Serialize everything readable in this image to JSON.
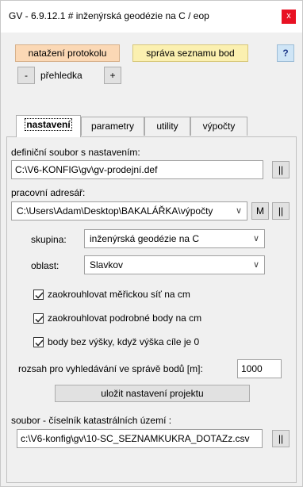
{
  "window": {
    "title": "GV - 6.9.12.1 # inženýrská geodézie na C / eop",
    "close_label": "x"
  },
  "toolbar": {
    "load_protocol_label": "natažení protokolu",
    "manage_points_label": "správa  seznamu bod",
    "help_label": "?",
    "minus_label": "-",
    "overview_label": "přehledka",
    "plus_label": "+"
  },
  "tabs": [
    {
      "label": "nastavení",
      "active": true
    },
    {
      "label": "parametry",
      "active": false
    },
    {
      "label": "utility",
      "active": false
    },
    {
      "label": "výpočty",
      "active": false
    }
  ],
  "settings": {
    "definition_file_label": "definiční soubor s nastavením:",
    "definition_file_value": "C:\\V6-KONFIG\\gv\\gv-prodejní.def",
    "browse_label": "||",
    "working_dir_label": "pracovní adresář:",
    "working_dir_value": "C:\\Users\\Adam\\Desktop\\BAKALÁŘKA\\výpočty",
    "m_label": "M",
    "group_label": "skupina:",
    "group_value": "inženýrská geodézie na C",
    "area_label": "oblast:",
    "area_value": "Slavkov",
    "checks": [
      {
        "label": "zaokrouhlovat měřickou síť na cm",
        "checked": true
      },
      {
        "label": "zaokrouhlovat podrobné body na cm",
        "checked": true
      },
      {
        "label": "body bez výšky, když výška cíle je 0",
        "checked": true
      }
    ],
    "search_range_label": "rozsah pro vyhledávání ve správě bodů [m]:",
    "search_range_value": "1000",
    "save_label": "uložit nastavení projektu",
    "cadastre_file_label": "soubor - číselník katastrálních území :",
    "cadastre_file_value": "c:\\V6-konfig\\gv\\10-SC_SEZNAMKUKRA_DOTAZz.csv"
  },
  "icons": {
    "chevron": "chevron-down-icon",
    "check": "checkmark-icon"
  }
}
